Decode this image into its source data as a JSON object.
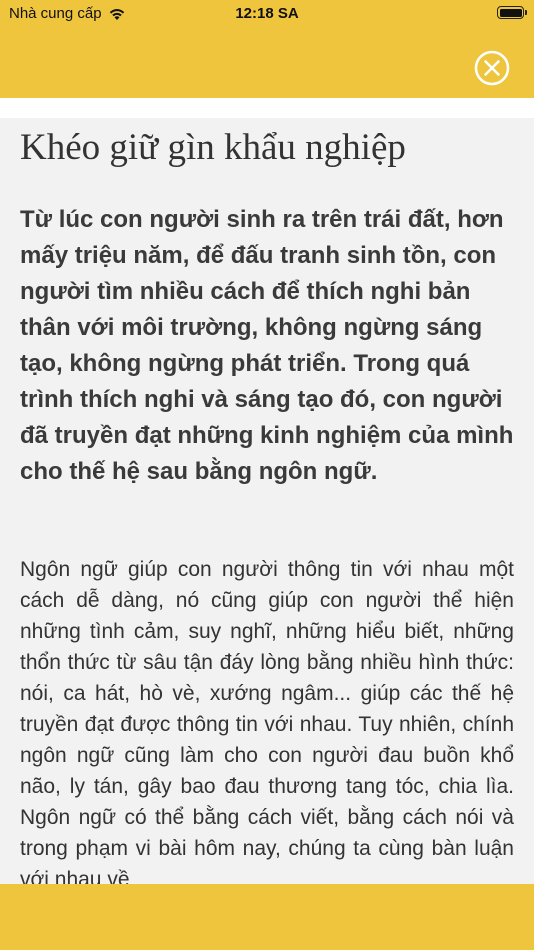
{
  "status_bar": {
    "carrier": "Nhà cung cấp",
    "time": "12:18 SA",
    "wifi_icon": "wifi-icon",
    "battery_icon": "battery-icon"
  },
  "header": {
    "close_icon": "close-icon",
    "background_color": "#f0c53e"
  },
  "article": {
    "title": "Khéo giữ gìn khẩu nghiệp",
    "lead": "Từ lúc con người sinh ra trên trái đất, hơn mấy triệu năm, để đấu tranh sinh tồn, con người tìm nhiều cách để thích nghi bản thân với môi trường, không ngừng sáng tạo, không ngừng phát triển. Trong quá trình thích nghi và sáng tạo đó, con người đã truyền đạt những kinh nghiệm của mình cho thế hệ sau bằng ngôn ngữ.",
    "body": "Ngôn ngữ giúp con người thông tin với nhau một cách dễ dàng, nó cũng giúp con người thể hiện những tình cảm, suy nghĩ, những hiểu biết, những thổn thức từ sâu tận đáy lòng bằng nhiều hình thức: nói, ca hát, hò vè, xướng ngâm... giúp các thế hệ truyền đạt được thông tin với nhau. Tuy nhiên, chính ngôn ngữ cũng làm cho con người đau buồn khổ não, ly tán, gây bao đau thương tang tóc, chia lìa. Ngôn ngữ có thể bằng cách viết, bằng cách nói và trong phạm vi bài hôm nay, chúng ta cùng bàn luận với nhau về"
  }
}
